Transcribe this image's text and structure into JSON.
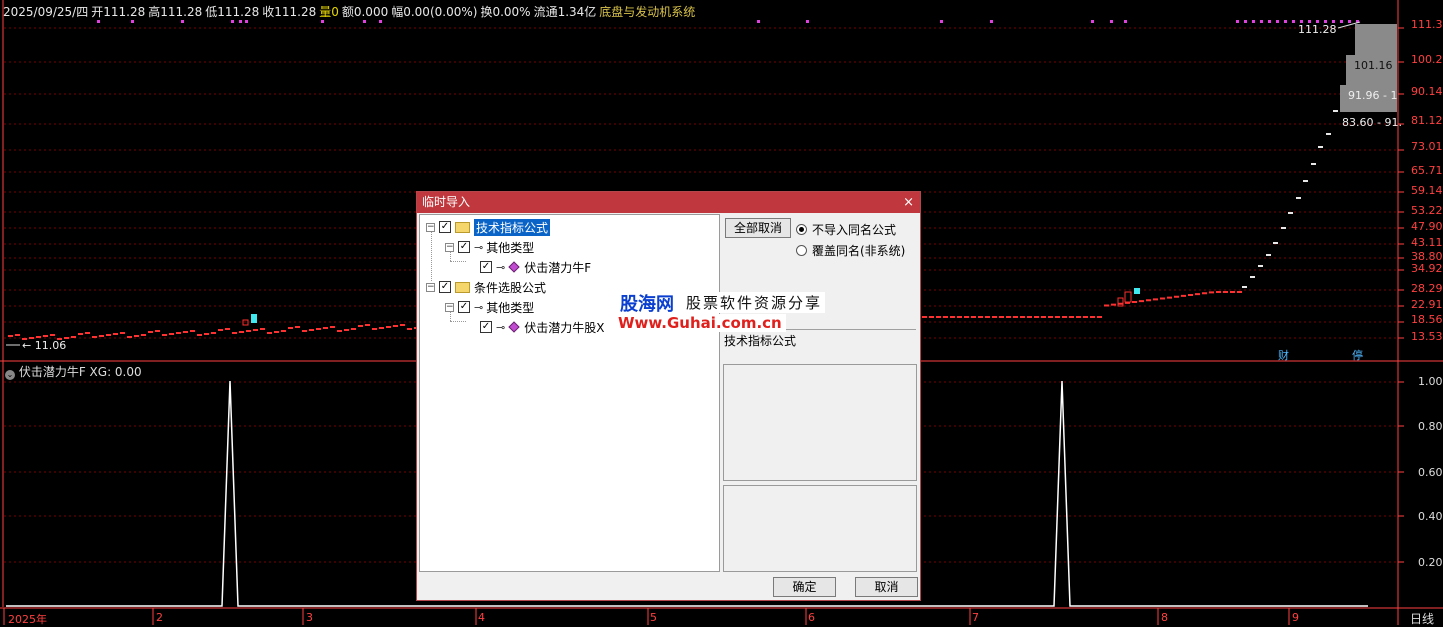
{
  "info_bar": {
    "date": "2025/09/25/四",
    "open": "开111.28",
    "high": "高111.28",
    "low": "低111.28",
    "close": "收111.28",
    "volume": "量0",
    "amount": "额0.000",
    "change": "幅0.00(0.00%)",
    "turnover": "换0.00%",
    "float": "流通1.34亿",
    "system_name": "底盘与发动机系统"
  },
  "price_axis": [
    "111.3",
    "100.2",
    "90.14",
    "81.12",
    "73.01",
    "65.71",
    "59.14",
    "53.22",
    "47.90",
    "43.11",
    "38.80",
    "34.92",
    "28.29",
    "22.91",
    "18.56",
    "13.53"
  ],
  "price_tags": {
    "last": "111.28",
    "tag2": "101.16",
    "tag3": "91.96 - 1",
    "tag4": "83.60 - 91.",
    "start": "← 11.06"
  },
  "markers": {
    "cai": "财",
    "ting": "停"
  },
  "indicator": {
    "title": "伏击潜力牛F XG: 0.00",
    "axis": [
      "1.00",
      "0.80",
      "0.60",
      "0.40",
      "0.20"
    ]
  },
  "x_axis": [
    "2025年",
    "2",
    "3",
    "4",
    "5",
    "6",
    "7",
    "8",
    "9"
  ],
  "period_label": "日线",
  "dialog": {
    "title": "临时导入",
    "close_glyph": "×",
    "tree": {
      "node1": "技术指标公式",
      "node1_child": "其他类型",
      "node1_leaf": "伏击潜力牛F",
      "node2": "条件选股公式",
      "node2_child": "其他类型",
      "node2_leaf": "伏击潜力牛股X"
    },
    "deselect_all": "全部取消",
    "radio_no_import": "不导入同名公式",
    "radio_overwrite": "覆盖同名(非系统)",
    "info_text": "技术指标公式",
    "ok": "确定",
    "cancel": "取消"
  },
  "watermark": {
    "brand": "股海网",
    "slogan": "股票软件资源分享",
    "url": "Www.Guhai.com.cn"
  },
  "colors": {
    "axis_red": "#ff4040",
    "grid_red": "#7a0000",
    "candle_up": "#ff3030",
    "candle_cyan": "#40e8f0",
    "title_bar": "#c0383d",
    "magenta_dots": "#e040e0"
  }
}
